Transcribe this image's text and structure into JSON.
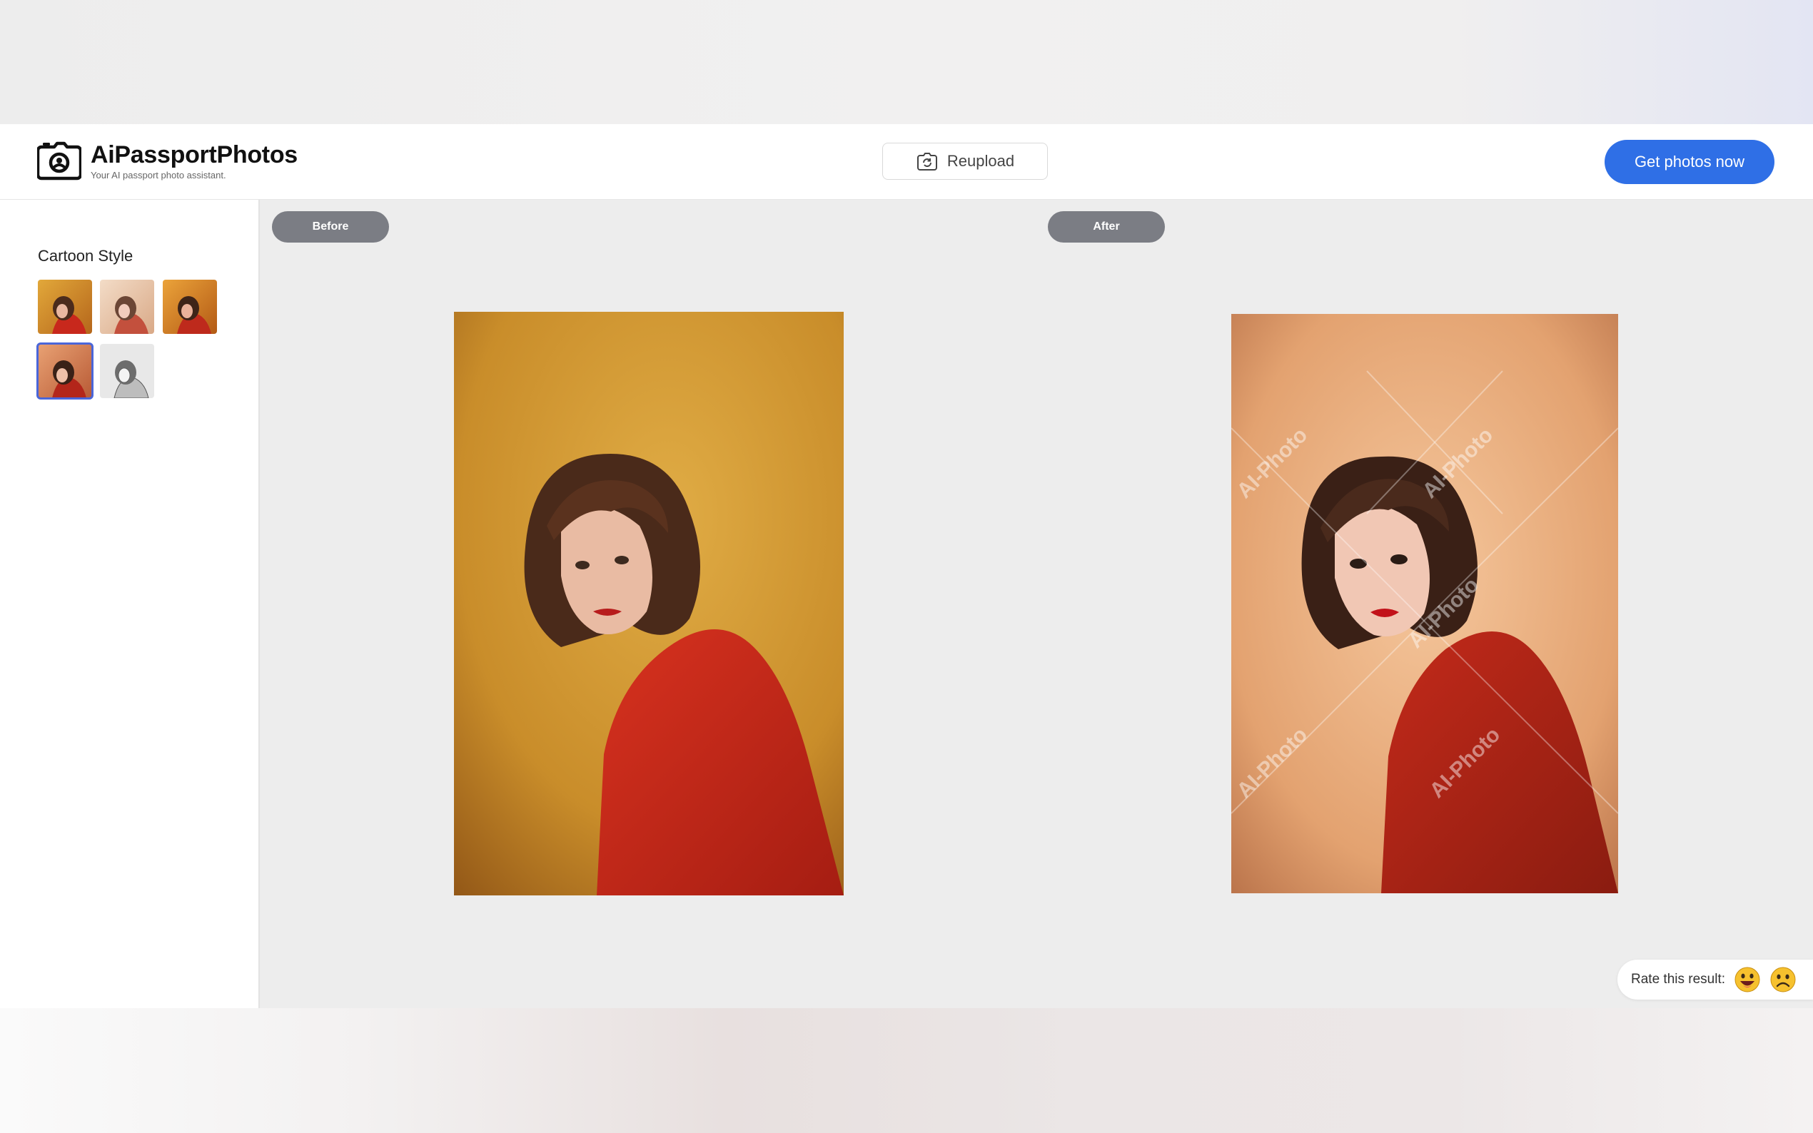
{
  "header": {
    "brand_name": "AiPassportPhotos",
    "brand_tagline": "Your AI passport photo assistant.",
    "reupload_label": "Reupload",
    "cta_label": "Get photos now",
    "cta_color": "#2f6fe6"
  },
  "sidebar": {
    "title": "Cartoon Style",
    "styles": [
      {
        "name": "style-1",
        "selected": false
      },
      {
        "name": "style-2",
        "selected": false
      },
      {
        "name": "style-3",
        "selected": false
      },
      {
        "name": "style-4",
        "selected": true
      },
      {
        "name": "style-5",
        "selected": false
      }
    ],
    "selected_outline_color": "#4a66d9"
  },
  "compare": {
    "before_label": "Before",
    "after_label": "After",
    "watermark": "AI-Photo"
  },
  "rating": {
    "label": "Rate this result:",
    "icons": [
      "happy-emoji-icon",
      "sad-emoji-icon"
    ]
  },
  "icons": {
    "logo": "camera-logo-icon",
    "reupload": "camera-rotate-icon"
  }
}
